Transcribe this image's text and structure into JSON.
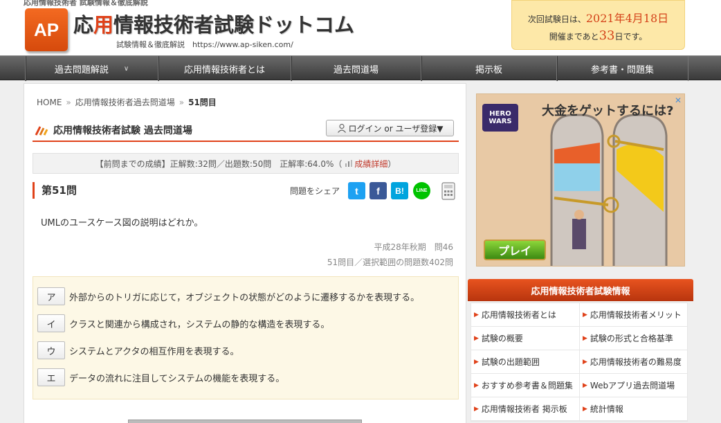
{
  "header": {
    "tagline": "応用情報技術者 試験情報＆徹底解説",
    "logo_badge": "AP",
    "title_pre": "応",
    "title_accent": "用",
    "title_post": "情報技術者試験ドットコム",
    "subtitle": "試験情報＆徹底解説　https://www.ap-siken.com/",
    "exam_prefix": "次回試験日は、",
    "exam_date": "2021年4月18日",
    "exam_countdown_prefix": "開催まであと",
    "exam_countdown_days": "33",
    "exam_countdown_suffix": "日です。"
  },
  "nav": {
    "items": [
      {
        "label": "過去問題解説",
        "has_dropdown": true
      },
      {
        "label": "応用情報技術者とは"
      },
      {
        "label": "過去問道場"
      },
      {
        "label": "掲示板"
      },
      {
        "label": "参考書・問題集"
      }
    ]
  },
  "breadcrumb": {
    "home": "HOME",
    "sep": "»",
    "level1": "応用情報技術者過去問道場",
    "current": "51問目"
  },
  "section": {
    "title": "応用情報技術者試験 過去問道場",
    "login_label": "ログイン or ユーザ登録▼"
  },
  "score": {
    "text": "【前問までの成績】正解数:32問／出題数:50問　正解率:64.0%（",
    "link": "成績詳細",
    "close": "）"
  },
  "question": {
    "heading": "第51問",
    "share_label": "問題をシェア",
    "text": "UMLのユースケース図の説明はどれか。",
    "meta_exam": "平成28年秋期　問46",
    "meta_range": "51問目／選択範囲の問題数402問",
    "choices": [
      {
        "key": "ア",
        "text": "外部からのトリガに応じて，オブジェクトの状態がどのように遷移するかを表現する。"
      },
      {
        "key": "イ",
        "text": "クラスと関連から構成され，システムの静的な構造を表現する。"
      },
      {
        "key": "ウ",
        "text": "システムとアクタの相互作用を表現する。"
      },
      {
        "key": "エ",
        "text": "データの流れに注目してシステムの機能を表現する。"
      }
    ]
  },
  "share_buttons": [
    {
      "name": "twitter",
      "glyph": "t",
      "color": "#1da1f2"
    },
    {
      "name": "facebook",
      "glyph": "f",
      "color": "#3b5998"
    },
    {
      "name": "hatena",
      "glyph": "B!",
      "color": "#00a4de"
    },
    {
      "name": "line",
      "glyph": "LINE",
      "color": "#00c300"
    }
  ],
  "ad": {
    "headline": "大金をゲットするには?",
    "logo": "HERO WARS",
    "play": "プレイ"
  },
  "sidebar": {
    "heading": "応用情報技術者試験情報",
    "links": [
      [
        "応用情報技術者とは",
        "応用情報技術者メリット"
      ],
      [
        "試験の概要",
        "試験の形式と合格基準"
      ],
      [
        "試験の出題範囲",
        "応用情報技術者の難易度"
      ],
      [
        "おすすめ参考書＆問題集",
        "Webアプリ過去問道場"
      ],
      [
        "応用情報技術者 掲示板",
        "統計情報"
      ]
    ]
  }
}
